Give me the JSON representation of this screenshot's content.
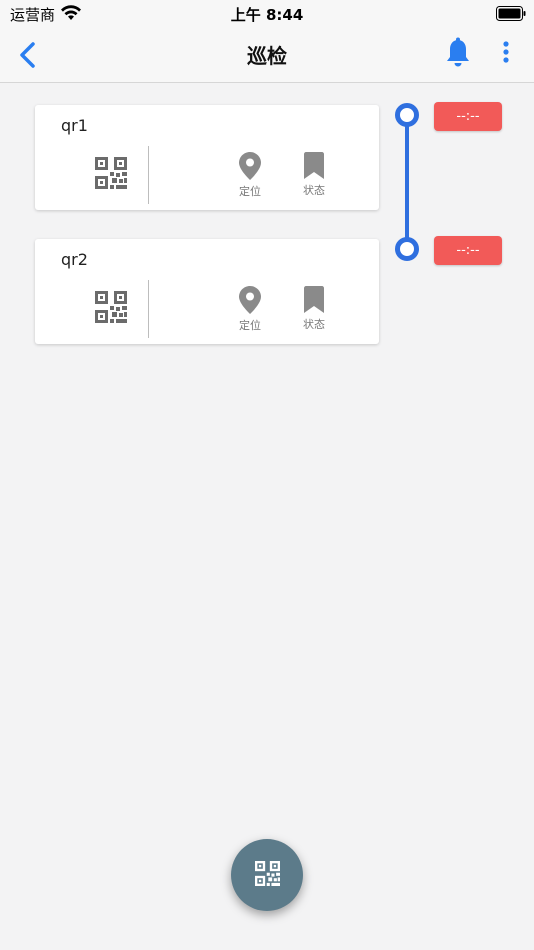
{
  "status_bar": {
    "carrier": "运营商",
    "time": "上午 8:44"
  },
  "nav": {
    "title": "巡检"
  },
  "checkpoints": [
    {
      "name": "qr1",
      "location_label": "定位",
      "status_label": "状态",
      "time": "--:--"
    },
    {
      "name": "qr2",
      "location_label": "定位",
      "status_label": "状态",
      "time": "--:--"
    }
  ],
  "colors": {
    "accent": "#2f6fdf",
    "badge": "#f25a58",
    "fab": "#5c7b8a",
    "icon": "#8a8a8a"
  },
  "icons": {
    "back": "chevron-left-icon",
    "bell": "bell-icon",
    "more": "more-vertical-icon",
    "qr": "qr-code-icon",
    "location": "location-pin-icon",
    "status": "bookmark-icon",
    "fab": "qr-scan-icon"
  }
}
